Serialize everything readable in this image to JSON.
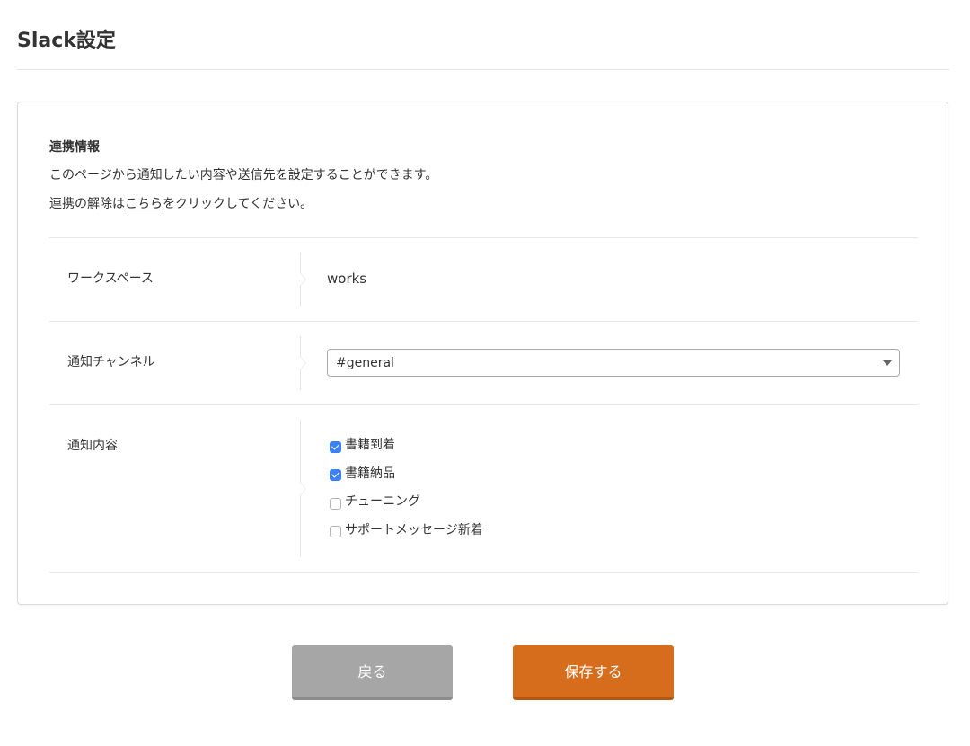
{
  "header": {
    "title": "Slack設定"
  },
  "card": {
    "section_title": "連携情報",
    "description_line1": "このページから通知したい内容や送信先を設定することができます。",
    "description_line2_prefix": "連携の解除は",
    "description_line2_link": "こちら",
    "description_line2_suffix": "をクリックしてください。"
  },
  "settings": {
    "workspace": {
      "label": "ワークスペース",
      "value": "works"
    },
    "channel": {
      "label": "通知チャンネル",
      "selected": "#general"
    },
    "content": {
      "label": "通知内容",
      "options": [
        {
          "label": "書籍到着",
          "checked": true
        },
        {
          "label": "書籍納品",
          "checked": true
        },
        {
          "label": "チューニング",
          "checked": false
        },
        {
          "label": "サポートメッセージ新着",
          "checked": false
        }
      ]
    }
  },
  "actions": {
    "back_label": "戻る",
    "save_label": "保存する"
  },
  "colors": {
    "save_button": "#d56d1d",
    "back_button": "#a6a6a6",
    "checkbox_checked": "#3b82f6"
  }
}
